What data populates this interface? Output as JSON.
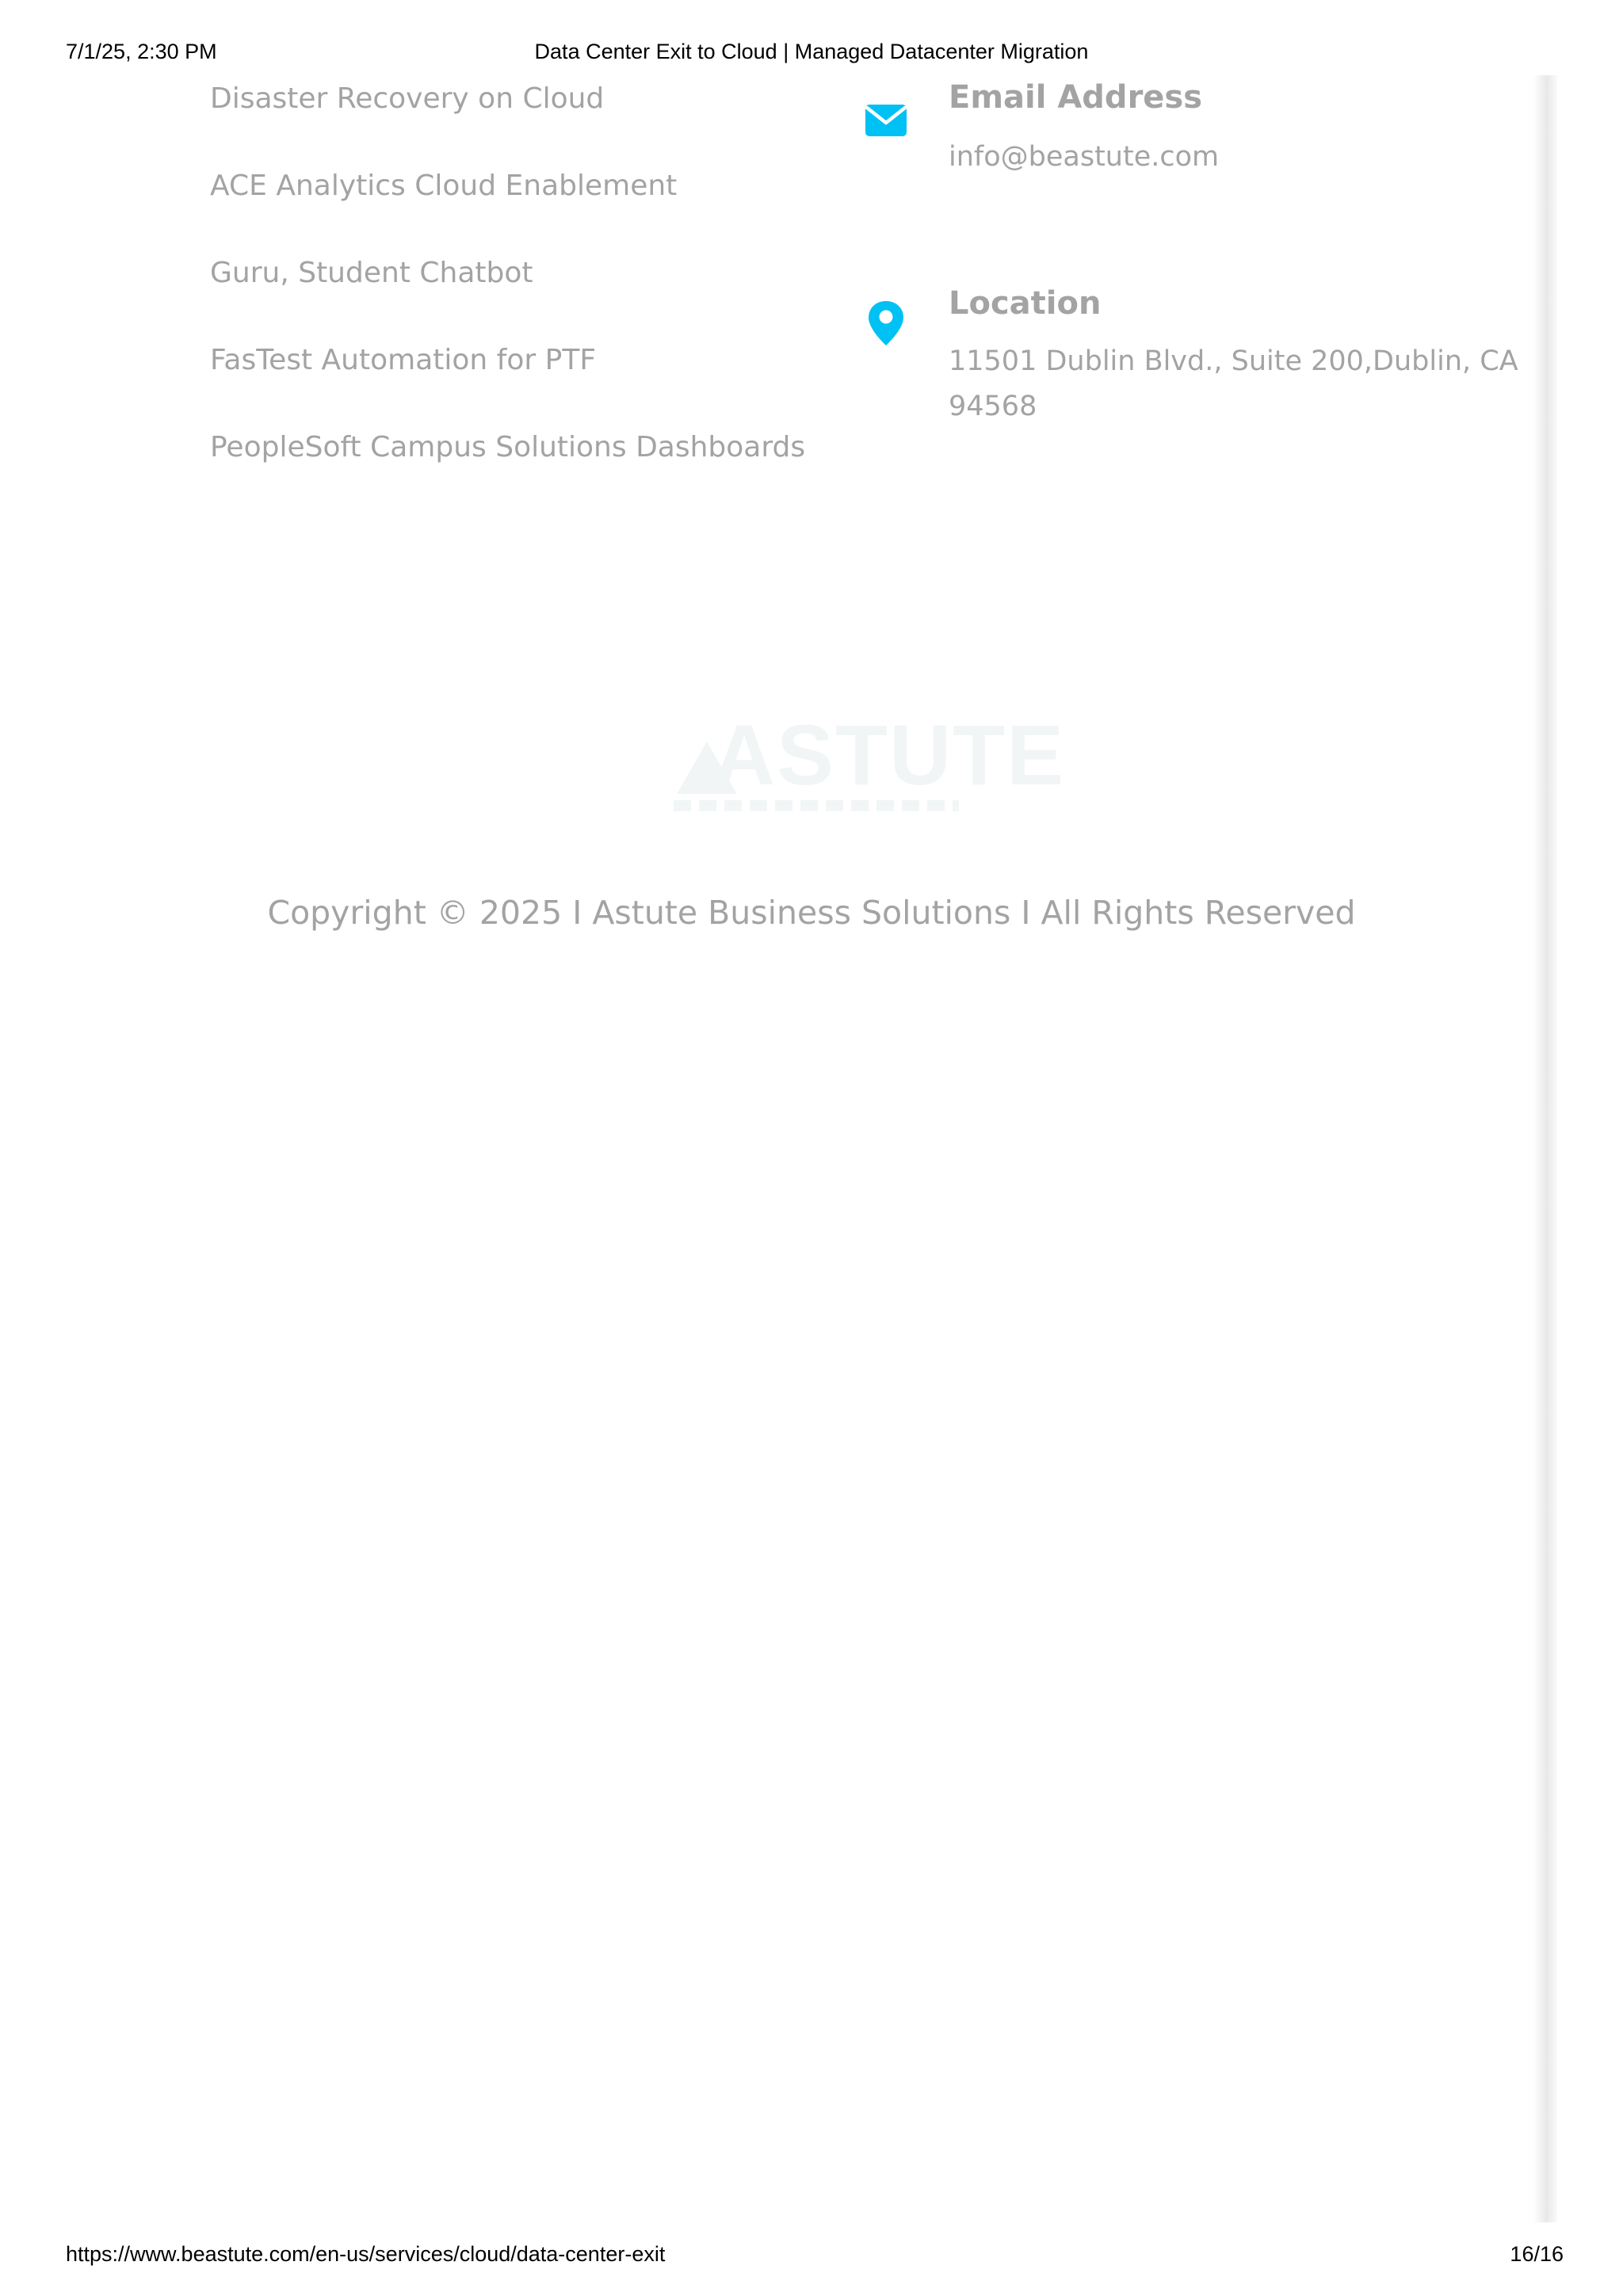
{
  "print_header": {
    "datetime": "7/1/25, 2:30 PM",
    "title": "Data Center Exit to Cloud | Managed Datacenter Migration"
  },
  "footer_links": [
    "Disaster Recovery on Cloud",
    "ACE Analytics Cloud Enablement",
    "Guru, Student Chatbot",
    "FasTest Automation for PTF",
    "PeopleSoft Campus Solutions Dashboards"
  ],
  "contact": {
    "email": {
      "icon": "envelope-icon",
      "title": "Email Address",
      "value": "info@beastute.com"
    },
    "location": {
      "icon": "map-pin-icon",
      "title": "Location",
      "value": "11501 Dublin Blvd., Suite 200,Dublin, CA 94568"
    }
  },
  "logo": {
    "text": "ASTUTE"
  },
  "copyright": "Copyright © 2025 I Astute Business Solutions I All Rights Reserved",
  "print_footer": {
    "url": "https://www.beastute.com/en-us/services/cloud/data-center-exit",
    "page": "16/16"
  },
  "colors": {
    "accent": "#00c1f3",
    "muted_text": "#a3a3a3",
    "background": "#ffffff"
  }
}
